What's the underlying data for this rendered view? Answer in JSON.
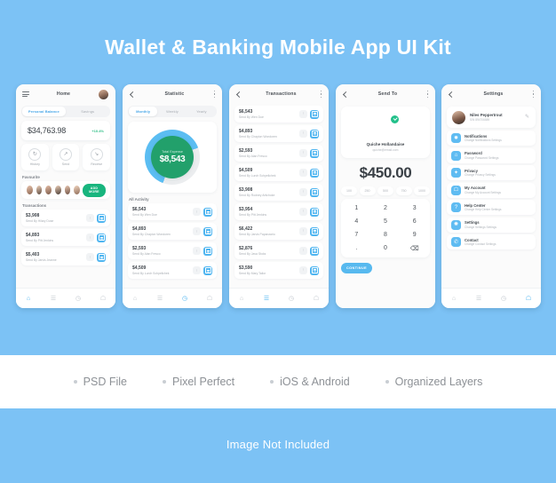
{
  "poster": {
    "title": "Wallet & Banking Mobile App UI Kit",
    "footer_note": "Image Not Included",
    "features": [
      "PSD File",
      "Pixel Perfect",
      "iOS & Android",
      "Organized Layers"
    ],
    "colors": {
      "background": "#7cc2f5",
      "accent_blue": "#4fb5f0",
      "accent_green": "#22a06b",
      "add_more_green": "#18b57e",
      "card_white": "#ffffff",
      "screen_bg": "#fbfbfb"
    }
  },
  "screen_home": {
    "title": "Home",
    "menu_icon": "hamburger-icon",
    "avatar_icon": "user-avatar",
    "tabs": [
      {
        "label": "Personal Balance",
        "active": true
      },
      {
        "label": "Savings",
        "active": false
      }
    ],
    "balance": {
      "amount": "$34,763.98",
      "change": "+10.4%"
    },
    "actions": [
      {
        "label": "History",
        "glyph": "↻"
      },
      {
        "label": "Send",
        "glyph": "↗"
      },
      {
        "label": "Receive",
        "glyph": "↘"
      }
    ],
    "favourite_label": "Favourite",
    "add_more_label": "ADD MORE",
    "favourites_count": 6,
    "transactions_label": "Transactions",
    "transactions": [
      {
        "amount": "$3,908",
        "sub": "Send By Hilary Dose"
      },
      {
        "amount": "$4,893",
        "sub": "Send By Pitt Jenkins"
      },
      {
        "amount": "$5,403",
        "sub": "Send By Jarvis Jeanne"
      }
    ],
    "nav": [
      "home-icon",
      "list-icon",
      "clock-icon",
      "person-icon"
    ],
    "nav_active": 0
  },
  "screen_statistic": {
    "title": "Statistic",
    "back_icon": "back-arrow-icon",
    "more_icon": "kebab-menu-icon",
    "tabs": [
      {
        "label": "Monthly",
        "active": true
      },
      {
        "label": "Weekly",
        "active": false
      },
      {
        "label": "Yearly",
        "active": false
      }
    ],
    "chart_data": {
      "type": "pie",
      "title": "Total Expense",
      "center_value": "$8,543",
      "categories": [
        "Expense",
        "Remaining"
      ],
      "values": [
        64,
        36
      ],
      "colors": [
        "#5bbdf2",
        "#ebedef"
      ],
      "legend": false,
      "grid": false
    },
    "activity_label": "All Activity",
    "activity": [
      {
        "amount": "$6,543",
        "sub": "Send By Wen Doe"
      },
      {
        "amount": "$4,893",
        "sub": "Send By Chapion Wondoren"
      },
      {
        "amount": "$2,593",
        "sub": "Send By Alan Fresco"
      },
      {
        "amount": "$4,509",
        "sub": "Send By Lurch Schpellchek"
      }
    ],
    "nav": [
      "home-icon",
      "list-icon",
      "clock-icon",
      "person-icon"
    ],
    "nav_active": 2
  },
  "screen_transactions": {
    "title": "Transactions",
    "back_icon": "back-arrow-icon",
    "more_icon": "kebab-menu-icon",
    "transactions": [
      {
        "amount": "$6,543",
        "sub": "Send By Wen Doe"
      },
      {
        "amount": "$4,893",
        "sub": "Send By Chapion Wondoren"
      },
      {
        "amount": "$2,593",
        "sub": "Send By Alan Fresco"
      },
      {
        "amount": "$4,509",
        "sub": "Send By Lurch Schpellchek"
      },
      {
        "amount": "$3,908",
        "sub": "Send By Rodney Artichoke"
      },
      {
        "amount": "$3,954",
        "sub": "Send By Pitt Jenkins"
      },
      {
        "amount": "$6,422",
        "sub": "Send By Jarvis Papanzario"
      },
      {
        "amount": "$2,876",
        "sub": "Send By Java Stoks"
      },
      {
        "amount": "$3,590",
        "sub": "Send By Mary Tailor"
      }
    ],
    "nav": [
      "home-icon",
      "list-icon",
      "clock-icon",
      "person-icon"
    ],
    "nav_active": 1
  },
  "screen_send": {
    "title": "Send To",
    "back_icon": "back-arrow-icon",
    "more_icon": "kebab-menu-icon",
    "recipient": {
      "name": "Quiche Hollandaise",
      "email": "quiche@email.com",
      "verified_badge": "check-badge-icon"
    },
    "amount": "$450.00",
    "quick_amounts": [
      "100",
      "250",
      "500",
      "750",
      "1000"
    ],
    "keypad": [
      "1",
      "2",
      "3",
      "4",
      "5",
      "6",
      "7",
      "8",
      "9",
      ".",
      "0",
      "⌫"
    ],
    "continue_label": "CONTINUE"
  },
  "screen_settings": {
    "title": "Settings",
    "back_icon": "back-arrow-icon",
    "more_icon": "kebab-menu-icon",
    "profile": {
      "name": "Niles Peppertrout",
      "id": "S/N 894706589",
      "edit_icon": "pencil-icon"
    },
    "items": [
      {
        "title": "Notifications",
        "sub": "Change Notifications Settings",
        "icon": "bell-icon"
      },
      {
        "title": "Password",
        "sub": "Change Password Settings",
        "icon": "lock-icon"
      },
      {
        "title": "Privacy",
        "sub": "Change Privacy Settings",
        "icon": "shield-icon"
      },
      {
        "title": "My Account",
        "sub": "Change My Account Settings",
        "icon": "person-icon"
      },
      {
        "title": "Help Center",
        "sub": "Change Help Center Settings",
        "icon": "question-icon"
      },
      {
        "title": "Settings",
        "sub": "Change Settings Settings",
        "icon": "gear-icon"
      },
      {
        "title": "Contact",
        "sub": "Change Contact Settings",
        "icon": "phone-icon"
      }
    ],
    "nav": [
      "home-icon",
      "list-icon",
      "clock-icon",
      "person-icon"
    ],
    "nav_active": 3
  }
}
